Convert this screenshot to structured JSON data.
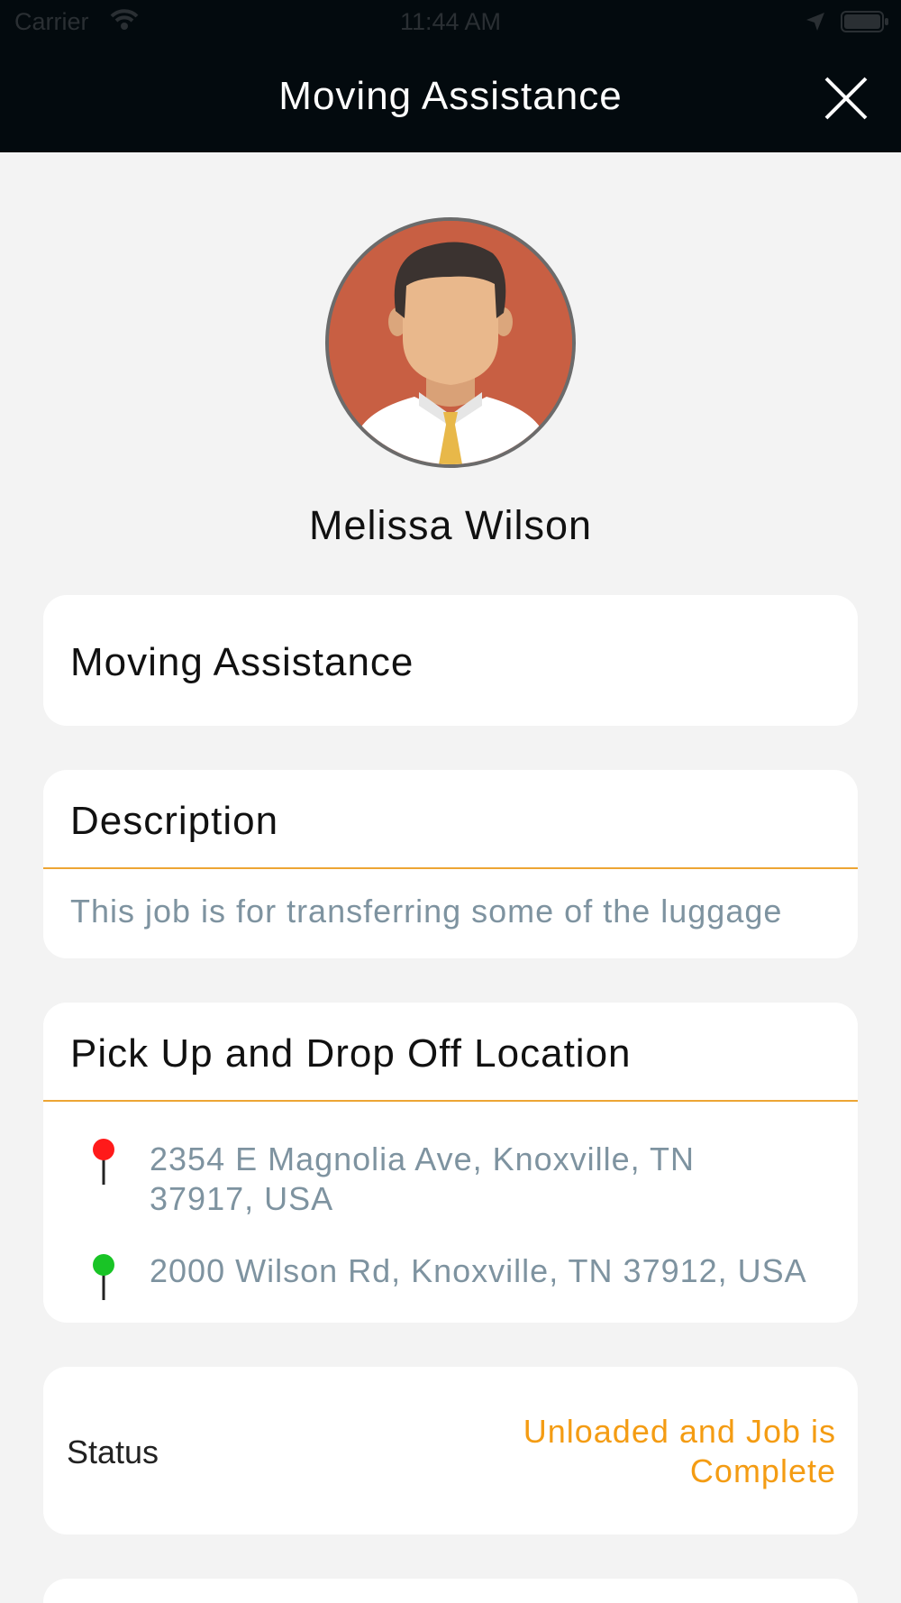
{
  "status_bar": {
    "carrier": "Carrier",
    "time": "11:44 AM"
  },
  "header": {
    "title": "Moving Assistance",
    "close_icon": "close-icon"
  },
  "profile": {
    "name": "Melissa Wilson",
    "avatar_colors": {
      "background": "#c85f43",
      "skin": "#e9b88c",
      "hair": "#3b3330",
      "shirt": "#ffffff",
      "tie": "#e8b849"
    }
  },
  "job": {
    "title": "Moving Assistance"
  },
  "description": {
    "heading": "Description",
    "text": "This job is for transferring some of the luggage"
  },
  "locations": {
    "heading": "Pick Up and Drop Off Location",
    "pickup": {
      "address": "2354 E Magnolia Ave, Knoxville, TN 37917, USA",
      "pin_color": "#ff1a1a"
    },
    "dropoff": {
      "address": "2000 Wilson Rd, Knoxville, TN 37912, USA",
      "pin_color": "#19c426"
    }
  },
  "status": {
    "label": "Status",
    "value": "Unloaded and Job is Complete"
  },
  "colors": {
    "header_bg": "#030a0e",
    "accent": "#eda534",
    "status_text": "#f49c13",
    "secondary_text": "#7e93a0",
    "page_bg": "#f3f3f3"
  }
}
